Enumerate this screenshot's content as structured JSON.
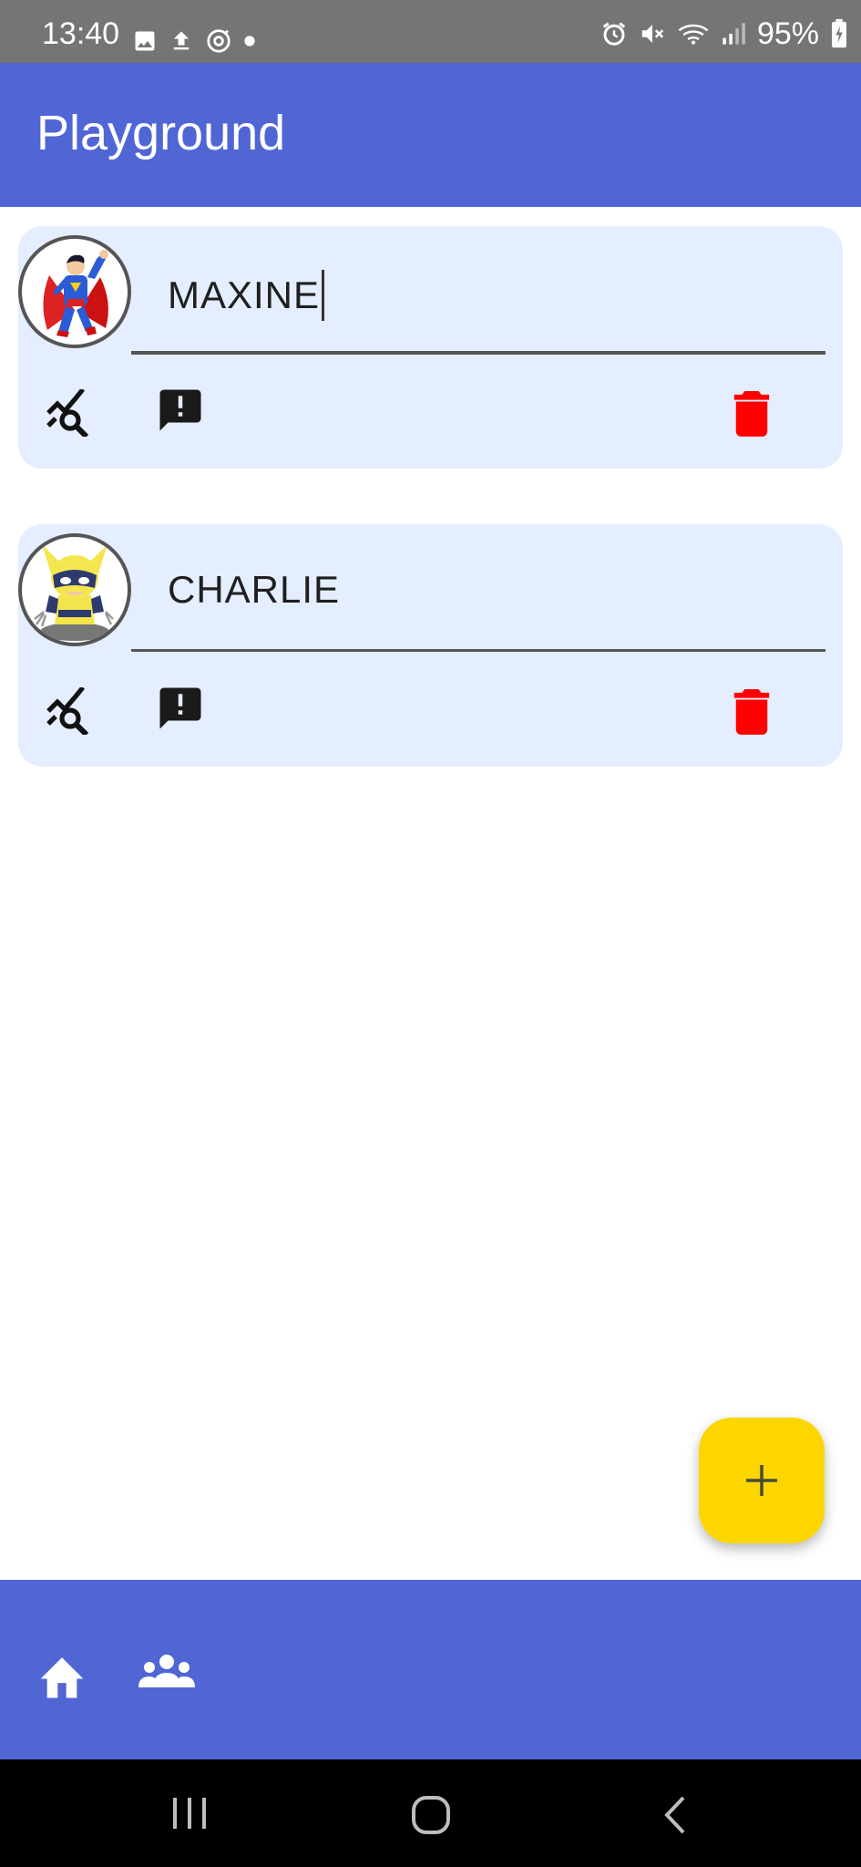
{
  "status_bar": {
    "time": "13:40",
    "battery": "95%",
    "left_icons": [
      "image-icon",
      "upload-icon",
      "sync-icon",
      "dot-icon"
    ],
    "right_icons": [
      "alarm-icon",
      "mute-icon",
      "wifi-icon",
      "signal-icon",
      "battery-charging-icon"
    ]
  },
  "app_bar": {
    "title": "Playground",
    "color": "#5066d4"
  },
  "players": [
    {
      "name": "MAXINE",
      "avatar": "superman-avatar",
      "focused": true
    },
    {
      "name": "CHARLIE",
      "avatar": "wolverine-avatar",
      "focused": false
    }
  ],
  "card_actions": [
    "analytics-search-icon",
    "report-icon",
    "delete-icon"
  ],
  "colors": {
    "card_bg": "#e5eeff",
    "delete": "#ff0000",
    "fab": "#fdd600"
  },
  "fab": {
    "icon": "add-icon"
  },
  "bottom_nav": {
    "items": [
      "home-icon",
      "groups-icon"
    ]
  },
  "system_nav": {
    "items": [
      "recents-icon",
      "home-circle-icon",
      "back-icon"
    ]
  }
}
